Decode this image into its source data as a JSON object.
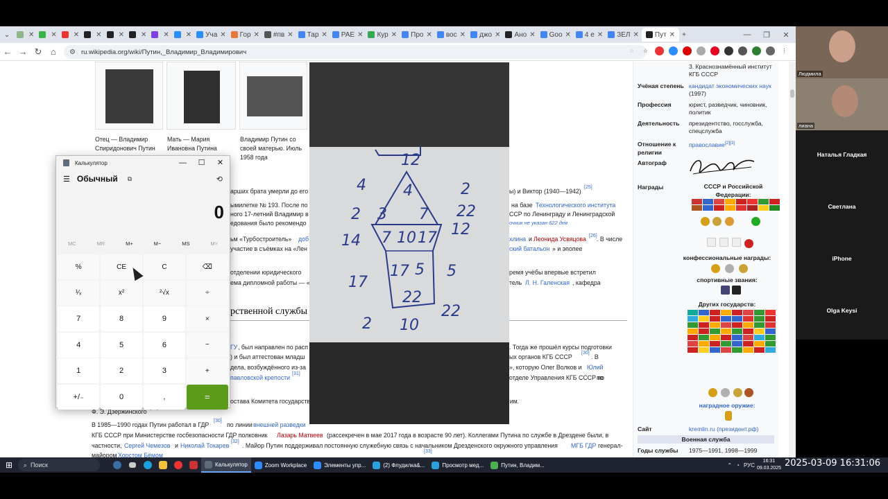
{
  "browser": {
    "tabs": [
      {
        "label": "",
        "color": "#8fb58a"
      },
      {
        "label": "",
        "color": "#38b449"
      },
      {
        "label": "",
        "color": "#e33"
      },
      {
        "label": "",
        "color": "#222"
      },
      {
        "label": "",
        "color": "#222"
      },
      {
        "label": "",
        "color": "#222"
      },
      {
        "label": "",
        "color": "#7b3fe4"
      },
      {
        "label": "",
        "color": "#2d8cff"
      },
      {
        "label": "Уча",
        "color": "#2d8cff"
      },
      {
        "label": "Гор",
        "color": "#e8773a"
      },
      {
        "label": "#пв",
        "color": "#555"
      },
      {
        "label": "Тар",
        "color": "#4285f4"
      },
      {
        "label": "PAE",
        "color": "#4285f4"
      },
      {
        "label": "Кур",
        "color": "#34a853"
      },
      {
        "label": "Про",
        "color": "#4285f4"
      },
      {
        "label": "вос",
        "color": "#4285f4"
      },
      {
        "label": "джо",
        "color": "#4285f4"
      },
      {
        "label": "Ано",
        "color": "#222"
      },
      {
        "label": "Goo",
        "color": "#4285f4"
      },
      {
        "label": "4 е",
        "color": "#4285f4"
      },
      {
        "label": "ЗЕЛ",
        "color": "#4285f4"
      },
      {
        "label": "Пут",
        "color": "#222",
        "active": true
      }
    ],
    "url": "ru.wikipedia.org/wiki/Путин,_Владимир_Владимирович"
  },
  "article": {
    "photos": [
      {
        "caption": "Отец — Владимир Спиридонович Путин"
      },
      {
        "caption": "Мать — Мария Ивановна Путина"
      },
      {
        "caption": "Владимир Путин со своей матерью. Июль 1958 года"
      }
    ],
    "lines": [
      "арших брата умерли до его",
      "ы) и Виктор (1940—1942)",
      "ымилетке № 193. После по",
      "на базе",
      "Технологического института",
      "ного 17-летний Владимир в",
      "ССР по Ленинграду и Ленинградской",
      "едования было рекомендо",
      "очник не указан 622 дня",
      "ьм «Турбостроитель»",
      "доб",
      "хлина",
      "и",
      "Леонида Усвяцова",
      ". В числе",
      "участие в съёмках на «Лен",
      "ский батальон",
      "» и эпопее",
      "отделении юридического",
      "ремя учёбы впервые встретил",
      "ема дипломной работы — «",
      "тель",
      "Л. Н. Галенская",
      ", кафедра",
      "рственной службы",
      "ГУ",
      ", был направлен по расп",
      ". Тогда же прошёл курсы подготовки",
      ") и был аттестован младш",
      "ых органов КГБ СССР",
      ". В",
      "дела, возбуждённого из-за",
      "», которую Олег Волков и",
      "Юлий",
      "павловской крепости",
      "отделе Управления КГБ СССР по",
      "остава Комитета государственной безопасности в Ленинграде (1976) и Высшей школе КГБ СССР им.",
      "Ф. Э. Дзержинского",
      "В 1985—1990 годах Путин работал в ГДР",
      "по линии",
      "внешней разведки",
      "КГБ СССР при Министерстве госбезопасности ГДР полковник",
      "Лазарь Матвеев",
      "(рассекречен в мае 2017 года в возрасте 90 лет). Коллегами Путина по службе в Дрездене были, в",
      "частности,",
      "Сергей Чемезов",
      "Николай Токарев",
      ". Майор Путин поддерживал постоянную служебную связь с начальником Дрезденского окружного управления",
      "МГБ ГДР",
      "генерал-",
      "майором",
      "Хорстом Бёмом",
      "Пу"
    ],
    "refs": [
      "[25]",
      "[26]",
      "[30]",
      "[31]",
      "[29]",
      "[30]",
      "[32]",
      "[33]"
    ],
    "extra": [
      "и",
      "По",
      "ья",
      "ветель",
      "ли",
      "по"
    ]
  },
  "infobox": {
    "alma_mater_tail": "3. Краснознамённый институт КГБ СССР",
    "degree_label": "Учёная степень",
    "degree_value": "кандидат экономических наук",
    "degree_year": "(1997)",
    "profession_label": "Профессия",
    "profession_value": "юрист, разведчик, чиновник, политик",
    "activity_label": "Деятельность",
    "activity_value": "президентство, госслужба, спецслужба",
    "religion_label": "Отношение к религии",
    "religion_value": "православие",
    "religion_refs": "[2][3]",
    "autograph_label": "Автограф",
    "awards_label": "Награды",
    "awards_ussr": "СССР и Российской Федерации:",
    "awards_confessional": "конфессиональные награды:",
    "awards_sport": "спортивные звания:",
    "awards_foreign": "Других государств:",
    "awards_weapon": "наградное оружие:",
    "site_label": "Сайт",
    "site_value": "kremlin.ru",
    "site_value2": "(президент.рф)",
    "military_band": "Военная служба",
    "service_label": "Годы службы",
    "service_value": "1975—1991, 1998—1999"
  },
  "calculator": {
    "title": "Калькулятор",
    "mode": "Обычный",
    "display": "0",
    "memory": [
      "MC",
      "MR",
      "M+",
      "M−",
      "MS",
      "M˅"
    ],
    "keys": [
      "%",
      "CE",
      "C",
      "⌫",
      "¹⁄ₓ",
      "x²",
      "²√x",
      "÷",
      "7",
      "8",
      "9",
      "×",
      "4",
      "5",
      "6",
      "−",
      "1",
      "2",
      "3",
      "+",
      "+/₋",
      "0",
      ",",
      "="
    ]
  },
  "shared_image": {
    "numbers": [
      "12",
      "4",
      "4",
      "2",
      "2",
      "3",
      "7",
      "22",
      "14",
      "7",
      "10",
      "17",
      "12",
      "17",
      "17",
      "5",
      "5",
      "22",
      "2",
      "10",
      "22"
    ]
  },
  "zoom": {
    "participants": [
      {
        "name": "Людмила",
        "video": true
      },
      {
        "name": "лиана",
        "video": true
      },
      {
        "name": "Наталья Гладкая",
        "video": false
      },
      {
        "name": "Светлана",
        "video": false
      },
      {
        "name": "iPhone",
        "video": false
      },
      {
        "name": "Olga Keysi",
        "video": false
      }
    ]
  },
  "taskbar": {
    "search": "Поиск",
    "apps": [
      {
        "label": "Калькулятор",
        "color": "#5d6b7a",
        "active": true
      },
      {
        "label": "Zoom Workplace",
        "color": "#2d8cff"
      },
      {
        "label": "Элементы упр...",
        "color": "#2d8cff"
      },
      {
        "label": "(2) Флудилка&...",
        "color": "#2aa1da"
      },
      {
        "label": "Просмотр мед...",
        "color": "#2aa1da"
      },
      {
        "label": "Путин, Владим...",
        "color": "#4caf50"
      }
    ],
    "lang": "РУС",
    "time": "16:31",
    "date": "09.03.2025"
  },
  "overlay_timestamp": "2025-03-09 16:31:06"
}
